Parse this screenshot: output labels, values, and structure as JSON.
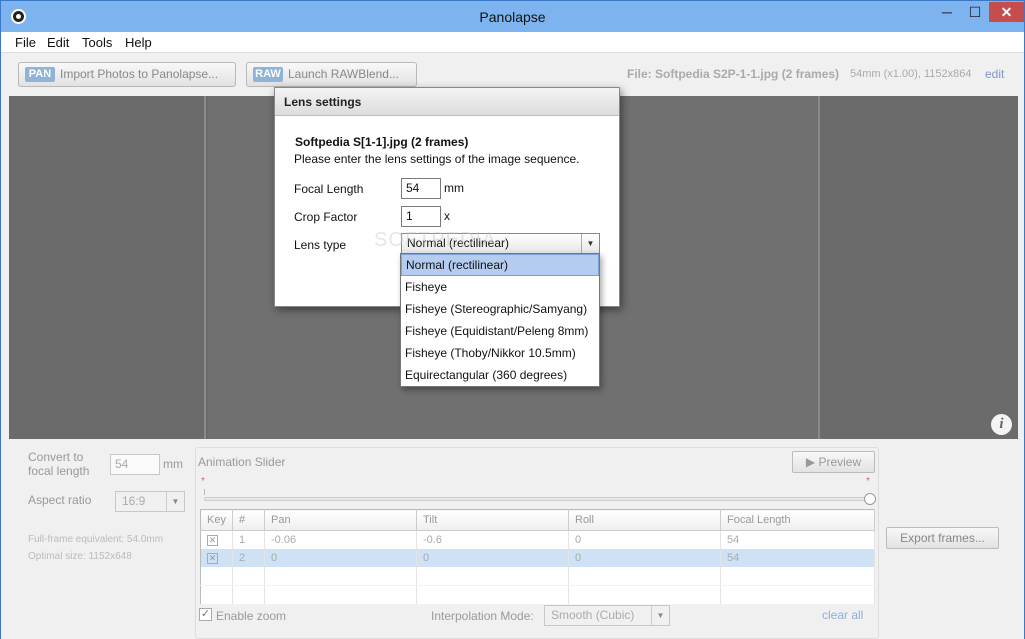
{
  "window": {
    "title": "Panolapse",
    "minimize": "─",
    "maximize": "☐",
    "close": "✕"
  },
  "menu": [
    "File",
    "Edit",
    "Tools",
    "Help"
  ],
  "toolbar": {
    "import_badge": "PAN",
    "import_label": "Import Photos to Panolapse...",
    "raw_badge": "RAW",
    "raw_label": "Launch RAWBlend...",
    "file_info": "File: Softpedia S2P-1-1.jpg (2 frames)",
    "file_sub": "54mm (x1.00), 1152x864",
    "edit": "edit"
  },
  "settings": {
    "convert_label_1": "Convert to",
    "convert_label_2": "focal length",
    "focal_value": "54",
    "focal_unit": "mm",
    "aspect_label": "Aspect ratio",
    "aspect_value": "16:9",
    "fullframe": "Full-frame equivalent: 54.0mm",
    "optimal": "Optimal size: 1152x648"
  },
  "animation": {
    "title": "Animation Slider",
    "preview": "Preview",
    "columns": [
      "Key",
      "#",
      "Pan",
      "Tilt",
      "Roll",
      "Focal Length"
    ],
    "rows": [
      [
        "1",
        "-0.06",
        "-0.6",
        "0",
        "54"
      ],
      [
        "2",
        "0",
        "0",
        "0",
        "54"
      ]
    ],
    "enable_zoom": "Enable zoom",
    "interp_label": "Interpolation Mode:",
    "interp_value": "Smooth (Cubic)",
    "clear_all": "clear all"
  },
  "export": "Export frames...",
  "dialog": {
    "title": "Lens settings",
    "file": "Softpedia S[1-1].jpg (2 frames)",
    "prompt": "Please enter the lens settings of the image sequence.",
    "focal_label": "Focal Length",
    "focal_value": "54",
    "focal_unit": "mm",
    "crop_label": "Crop Factor",
    "crop_value": "1",
    "crop_unit": "x",
    "lens_label": "Lens type",
    "lens_value": "Normal (rectilinear)"
  },
  "lens_options": [
    "Normal (rectilinear)",
    "Fisheye",
    "Fisheye (Stereographic/Samyang)",
    "Fisheye (Equidistant/Peleng 8mm)",
    "Fisheye (Thoby/Nikkor 10.5mm)",
    "Equirectangular (360 degrees)"
  ],
  "watermark": "SOFTPEDIA"
}
